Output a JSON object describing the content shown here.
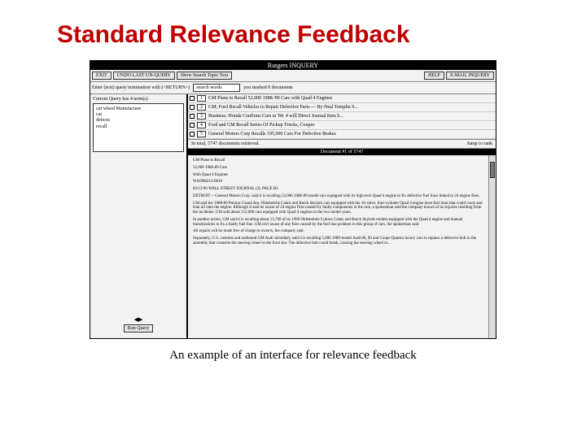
{
  "slide": {
    "title": "Standard Relevance Feedback",
    "caption": "An example of an interface for relevance feedback"
  },
  "window": {
    "titlebar": "Rutgers INQUERY"
  },
  "toolbar": {
    "exit": "EXIT",
    "undo": "UNDO LAST UN-QUERY",
    "show": "Show Search Topic Text",
    "help": "HELP",
    "email": "E-MAIL INQUERY"
  },
  "queryrow": {
    "prompt": "Enter (text) query termination with (<RETURN>)",
    "search_value": "search words",
    "marked_msg": "you marked 0 documents"
  },
  "leftpane": {
    "label": "Current Query has 4 term(s)",
    "terms": [
      "car wheel Manufacture",
      "car",
      "defects",
      "recall"
    ],
    "run_label": "Run Query"
  },
  "results": {
    "items": [
      {
        "n": "1",
        "title": "GM Plans to Recall 52,000 1988-'89 Cars with Quad 4 Engines"
      },
      {
        "n": "2",
        "title": "GM, Ford Recall Vehicles to Repair Defective Parts --- By Neal Templin S..."
      },
      {
        "n": "3",
        "title": "Business: Honda Confirms Cars in '84. 4 will Direct Journal Item h..."
      },
      {
        "n": "4",
        "title": "Ford and GM Recall Series Of Pickup Trucks, Coupes"
      },
      {
        "n": "5",
        "title": "General Motors Corp Recalls 195,000 Cars For Defective Brakes"
      }
    ],
    "count_line": "In total, 5747 documents retrieved.",
    "jump_label": "Jump to rank"
  },
  "doc": {
    "header": "Document #1 of 5747",
    "paragraphs": [
      "GM Plans to Recall",
      "52,000 1988-89 Cars",
      "With Quad 4 Engines",
      "WSJ900213-0010",
      "02/13/90 WALL STREET JOURNAL (J), PAGE B2",
      "DETROIT -- General Motors Corp. said it is recalling 52,000 1988-89 model cars equipped with its high-tech Quad 4 engine to fix defective fuel lines linked to 24 engine fires.",
      "GM said the 1988-89 Pontiac Grand Am, Oldsmobile Calais and Buick Skylark cars equipped with the 16-valve, four-cylinder Quad 4 engine have fuel lines that could crack and leak oil onto the engine. Although it said its aware of 24 engine fires caused by faulty components in the cars, a spokesman said the company knows of no injuries resulting from the incidents. GM sold about 152,000 cars equipped with Quad 4 engines in the two model years.",
      "In another action, GM said it is recalling about 13,700 of its 1990 Oldsmobile Cutlass Calais and Buick Skylark models equipped with the Quad 4 engine and manual transmissions to fix a faulty fuel line. GM isn't aware of any fires caused by the fuel line problem in this group of cars, the spokesman said.",
      "All repairs will be made free of charge to owners, the company said.",
      "Separately, U.S. customs and outbound GM Audi subsidiary said it is recalling 5,600 1989-model Audi 80, 90 and Coupe Quattro luxury cars to replace a defective bolt in the assembly that connects the steering wheel to the front tire. The defective bolt could break, causing the steering wheel to..."
    ]
  }
}
